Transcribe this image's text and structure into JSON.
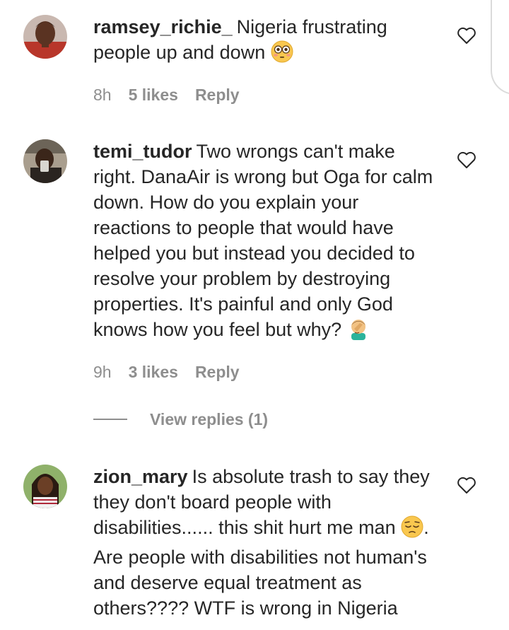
{
  "comments": [
    {
      "username": "ramsey_richie_",
      "text": "Nigeria frustrating people up and down",
      "emoji": "flushed-face",
      "time": "8h",
      "likes": "5 likes",
      "reply": "Reply"
    },
    {
      "username": "temi_tudor",
      "text": "Two wrongs can't make right. DanaAir is wrong but Oga for calm down. How do you explain your reactions to people that would have helped you but instead you decided to resolve your problem by destroying properties. It's painful and only God knows how you feel but why?",
      "emoji": "man-facepalming",
      "time": "9h",
      "likes": "3 likes",
      "reply": "Reply",
      "view_replies": "View replies (1)"
    },
    {
      "username": "zion_mary",
      "text_part1": "Is absolute trash to say they they don't board people with disabilities...... this shit hurt me man",
      "emoji": "pensive-face",
      "text_part2": ". Are people with disabilities not human's and deserve equal treatment as others???? WTF is wrong in Nigeria"
    }
  ],
  "colors": {
    "text": "#262626",
    "meta": "#8e8e8e",
    "background": "#ffffff"
  }
}
